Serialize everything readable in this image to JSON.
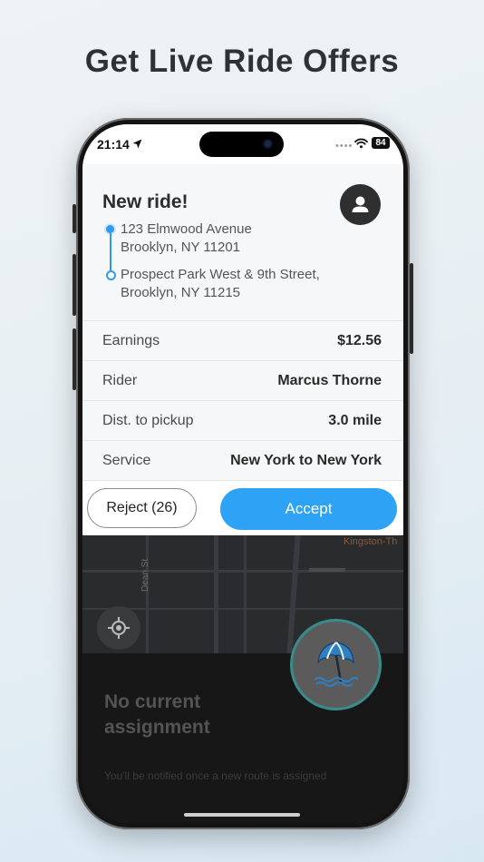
{
  "headline": "Get Live Ride Offers",
  "status_bar": {
    "time": "21:14",
    "dots": "••••",
    "battery": "84"
  },
  "ride": {
    "title": "New ride!",
    "pickup": {
      "line1": "123 Elmwood Avenue",
      "line2": "Brooklyn, NY 11201"
    },
    "dropoff": {
      "line1": "Prospect Park West & 9th Street,",
      "line2": "Brooklyn, NY 11215"
    },
    "details": [
      {
        "label": "Earnings",
        "value": "$12.56"
      },
      {
        "label": "Rider",
        "value": "Marcus Thorne"
      },
      {
        "label": "Dist. to pickup",
        "value": "3.0 mile"
      },
      {
        "label": "Service",
        "value": "New York to New York"
      }
    ],
    "reject_label": "Reject (26)",
    "accept_label": "Accept"
  },
  "map": {
    "street_dean": "Dean St",
    "street_kingston": "Kingston-Th"
  },
  "assignment": {
    "title_line1": "No current",
    "title_line2": "assignment",
    "note": "You'll be notified once a new route is assigned"
  },
  "colors": {
    "accent": "#2ea3f5",
    "route": "#2e9bf0",
    "fab_ring": "#3a8c8c"
  },
  "icons": {
    "location": "location-arrow-icon",
    "wifi": "wifi-icon",
    "avatar": "user-icon",
    "locate": "crosshair-icon",
    "fab": "beach-umbrella-icon"
  }
}
